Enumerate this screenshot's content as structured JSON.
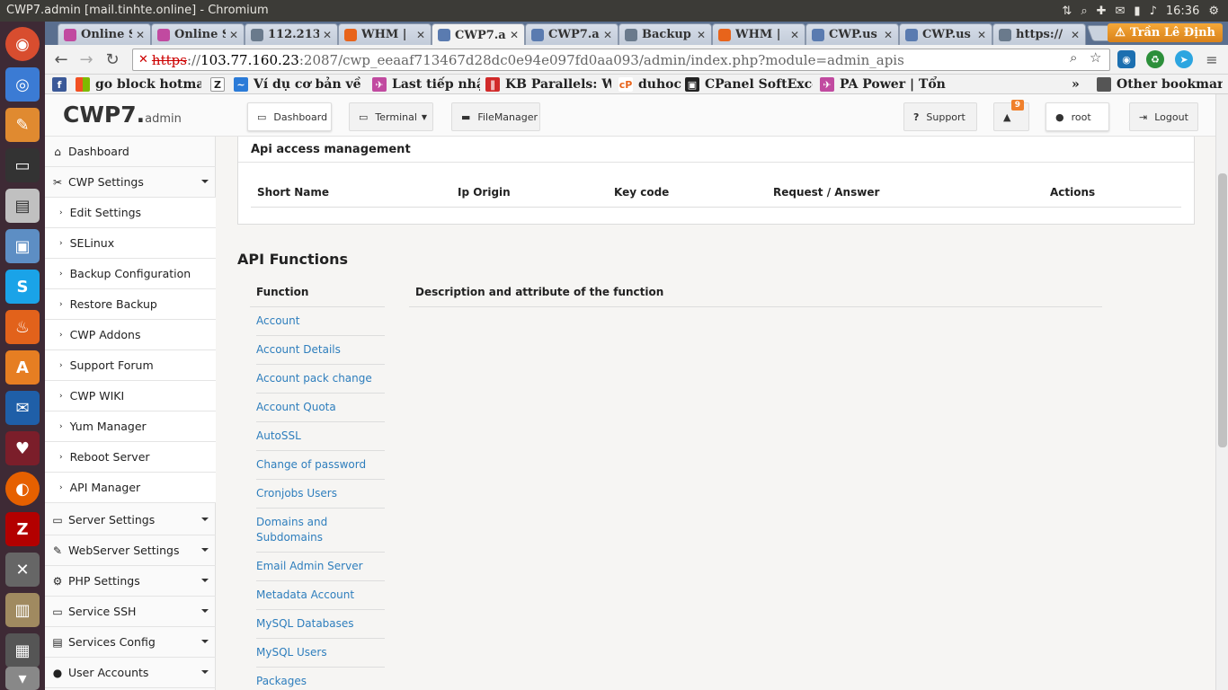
{
  "window": {
    "title": "CWP7.admin [mail.tinhte.online] - Chromium"
  },
  "tray": {
    "time": "16:36",
    "user": "Trần Lê Định"
  },
  "tabs": [
    {
      "label": "Online S",
      "color": "#c14aa0"
    },
    {
      "label": "Online S",
      "color": "#c14aa0"
    },
    {
      "label": "112.213",
      "color": "#6a7a8c"
    },
    {
      "label": "WHM |",
      "color": "#e8641b"
    },
    {
      "label": "CWP7.a",
      "color": "#5a7bb0"
    },
    {
      "label": "CWP7.a",
      "color": "#5a7bb0"
    },
    {
      "label": "Backup",
      "color": "#6a7a8c"
    },
    {
      "label": "WHM |",
      "color": "#e8641b"
    },
    {
      "label": "CWP.us",
      "color": "#5a7bb0"
    },
    {
      "label": "CWP.us",
      "color": "#5a7bb0"
    },
    {
      "label": "https://",
      "color": "#6a7a8c"
    }
  ],
  "address": {
    "scheme": "https",
    "sep": "://",
    "host": "103.77.160.23",
    "path": ":2087/cwp_eeaaf713467d28dc0e94e097fd0aa093/admin/index.php?module=admin_apis"
  },
  "bookmarks": {
    "items": [
      "go block hotmail !",
      "Ví dụ cơ bản về lệ",
      "Last tiếp nhận",
      "KB Parallels: Wh",
      "duhoc",
      "CPanel SoftExcep",
      "PA Power | Tổng c"
    ],
    "other": "Other bookmarks",
    "overflow": "»"
  },
  "brand": {
    "name": "CWP7.",
    "suffix": "admin"
  },
  "topnav": {
    "dashboard": "Dashboard",
    "terminal": "Terminal",
    "filemanager": "FileManager",
    "support": "Support",
    "notif_count": "9",
    "user": "root",
    "logout": "Logout"
  },
  "sidebar": {
    "dashboard": "Dashboard",
    "cwp_settings": "CWP Settings",
    "sub": [
      "Edit Settings",
      "SELinux",
      "Backup Configuration",
      "Restore Backup",
      "CWP Addons",
      "Support Forum",
      "CWP WIKI",
      "Yum Manager",
      "Reboot Server",
      "API Manager"
    ],
    "groups": [
      "Server Settings",
      "WebServer Settings",
      "PHP Settings",
      "Service SSH",
      "Services Config",
      "User Accounts"
    ]
  },
  "api_access": {
    "title": "Api access management",
    "columns": [
      "Short Name",
      "Ip Origin",
      "Key code",
      "Request / Answer",
      "Actions"
    ]
  },
  "api_functions": {
    "title": "API Functions",
    "col_function": "Function",
    "col_desc": "Description and attribute of the function",
    "items": [
      "Account",
      "Account Details",
      "Account pack change",
      "Account Quota",
      "AutoSSL",
      "Change of password",
      "Cronjobs Users",
      "Domains and Subdomains",
      "Email Admin Server",
      "Metadata Account",
      "MySQL Databases",
      "MySQL Users",
      "Packages"
    ]
  }
}
